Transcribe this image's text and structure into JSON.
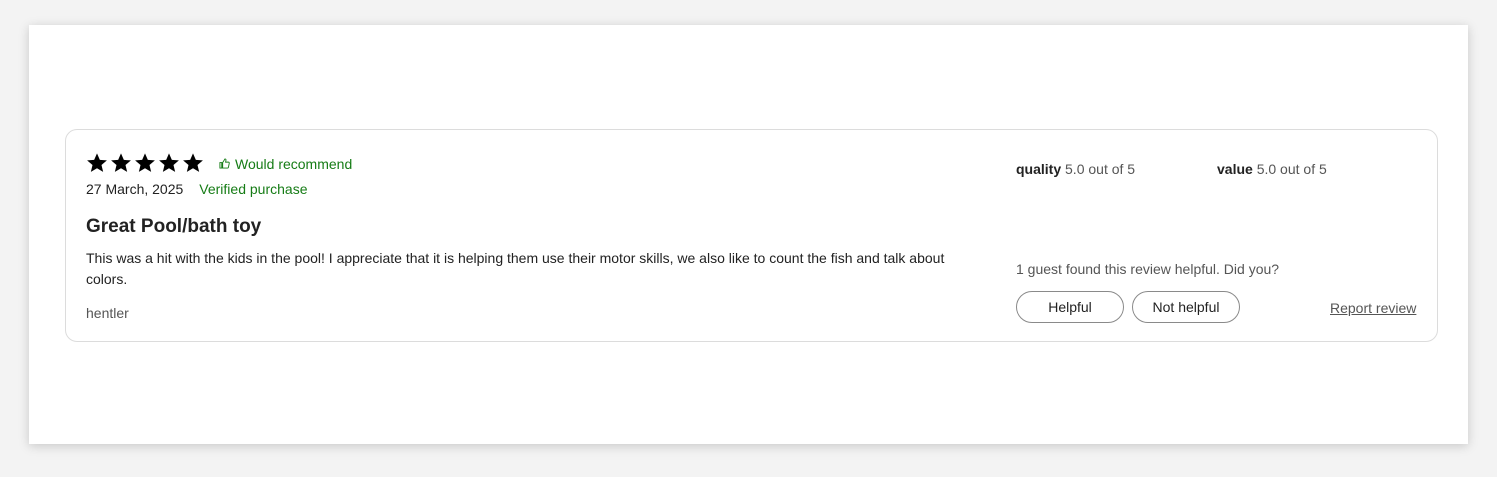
{
  "review": {
    "stars": 5,
    "recommend_label": "Would recommend",
    "date": "27 March, 2025",
    "verified_label": "Verified purchase",
    "title": "Great Pool/bath toy",
    "body": "This was a hit with the kids in the pool! I appreciate that it is helping them use their motor skills, we also like to count the fish and talk about colors.",
    "author": "hentler"
  },
  "ratings": {
    "quality_label": "quality",
    "quality_value": "5.0 out of 5",
    "value_label": "value",
    "value_value": "5.0 out of 5"
  },
  "feedback": {
    "prompt": "1 guest found this review helpful. Did you?",
    "helpful_label": "Helpful",
    "not_helpful_label": "Not helpful",
    "report_label": "Report review"
  },
  "colors": {
    "accent_green": "#167c16",
    "star": "#000000",
    "border": "#dcdcdc"
  }
}
